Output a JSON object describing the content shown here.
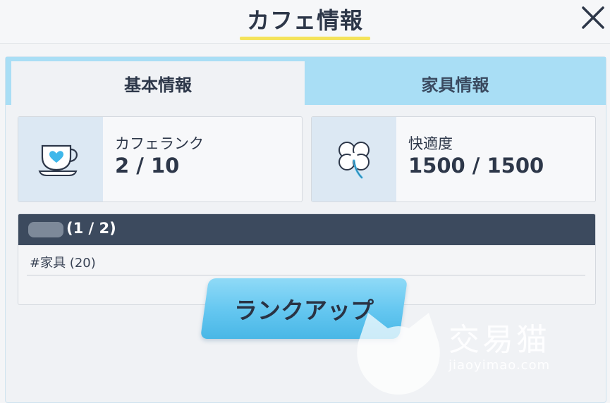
{
  "header": {
    "title": "カフェ情報"
  },
  "tabs": [
    {
      "label": "基本情報",
      "active": true
    },
    {
      "label": "家具情報",
      "active": false
    }
  ],
  "stats": {
    "rank": {
      "icon": "teacup-heart-icon",
      "label": "カフェランク",
      "value": "2 / 10"
    },
    "comfort": {
      "icon": "clover-icon",
      "label": "快適度",
      "value": "1500 / 1500"
    }
  },
  "requirements": {
    "header": "(1 / 2)",
    "items": [
      "#家具 (20)"
    ]
  },
  "actions": {
    "rank_up_label": "ランクアップ"
  },
  "watermark": {
    "text": "交易猫",
    "url": "jiaoyimao.com"
  },
  "colors": {
    "tab_bar": "#a9def5",
    "underline": "#f4e35a",
    "req_header": "#3c4a5e",
    "button": "#63c6f0",
    "icon_accent": "#3fb7ea"
  }
}
